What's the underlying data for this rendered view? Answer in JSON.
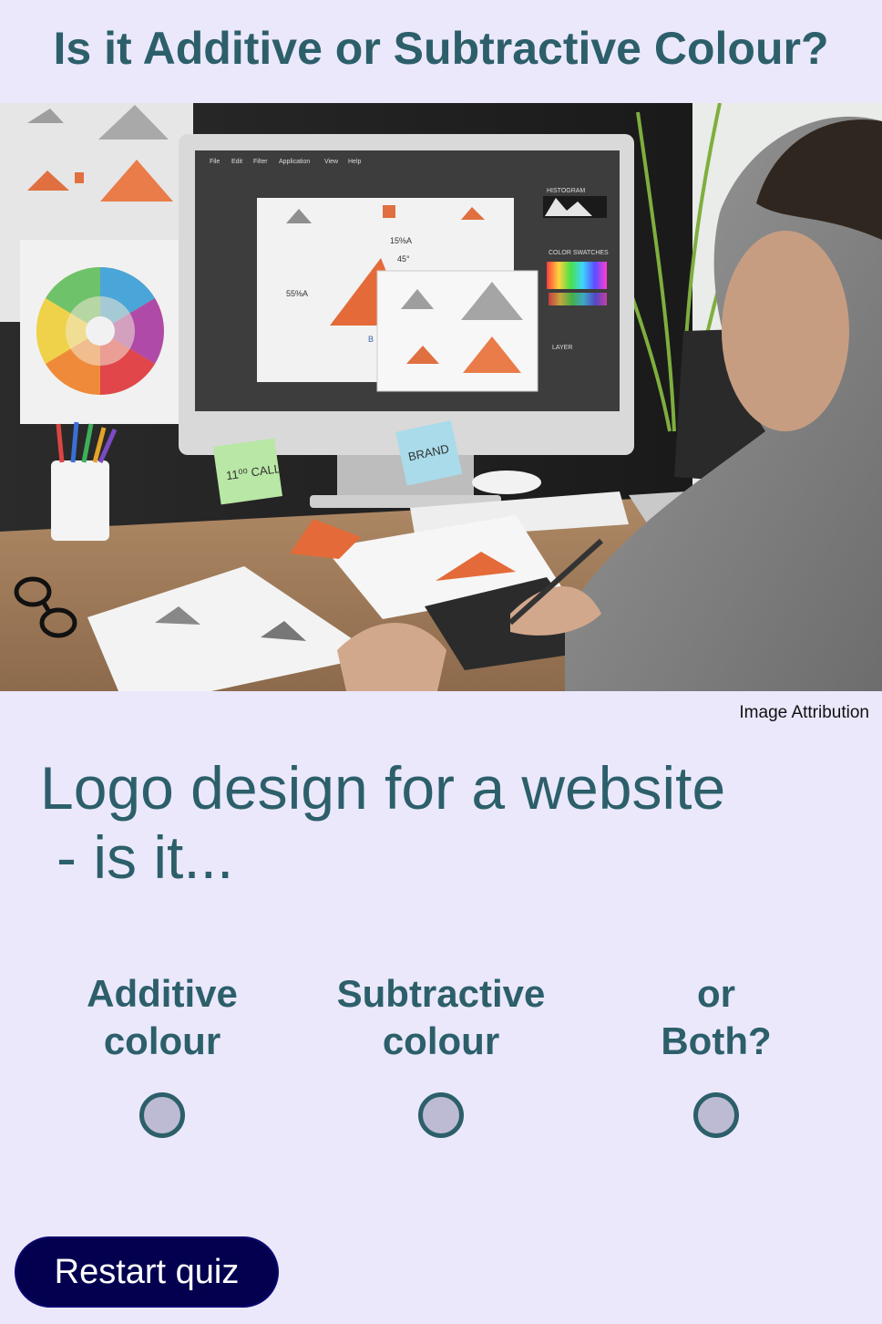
{
  "header": {
    "title": "Is it Additive or Subtractive Colour?"
  },
  "image": {
    "attribution_label": "Image Attribution",
    "app_menu": [
      "File",
      "Edit",
      "Filter",
      "Application",
      "View",
      "Help"
    ],
    "panel_labels": {
      "histogram": "HISTOGRAM",
      "swatches": "COLOR SWATCHES",
      "layer": "LAYER"
    },
    "artboard_labels": {
      "top": "15%A",
      "left": "55%A",
      "angle": "45°",
      "bottom": "B"
    },
    "sticky_notes": {
      "green": "11⁰⁰ CALL",
      "blue": "BRAND"
    }
  },
  "question": {
    "line1": "Logo design for a website",
    "line2": "- is it..."
  },
  "options": [
    {
      "line1": "Additive",
      "line2": "colour"
    },
    {
      "line1": "Subtractive",
      "line2": "colour"
    },
    {
      "line1": "or",
      "line2": "Both?"
    }
  ],
  "actions": {
    "restart_label": "Restart quiz"
  },
  "colors": {
    "background": "#ebe8fc",
    "accent": "#2c5f6a",
    "button": "#03004f",
    "radio_fill": "#bdbbd3"
  }
}
